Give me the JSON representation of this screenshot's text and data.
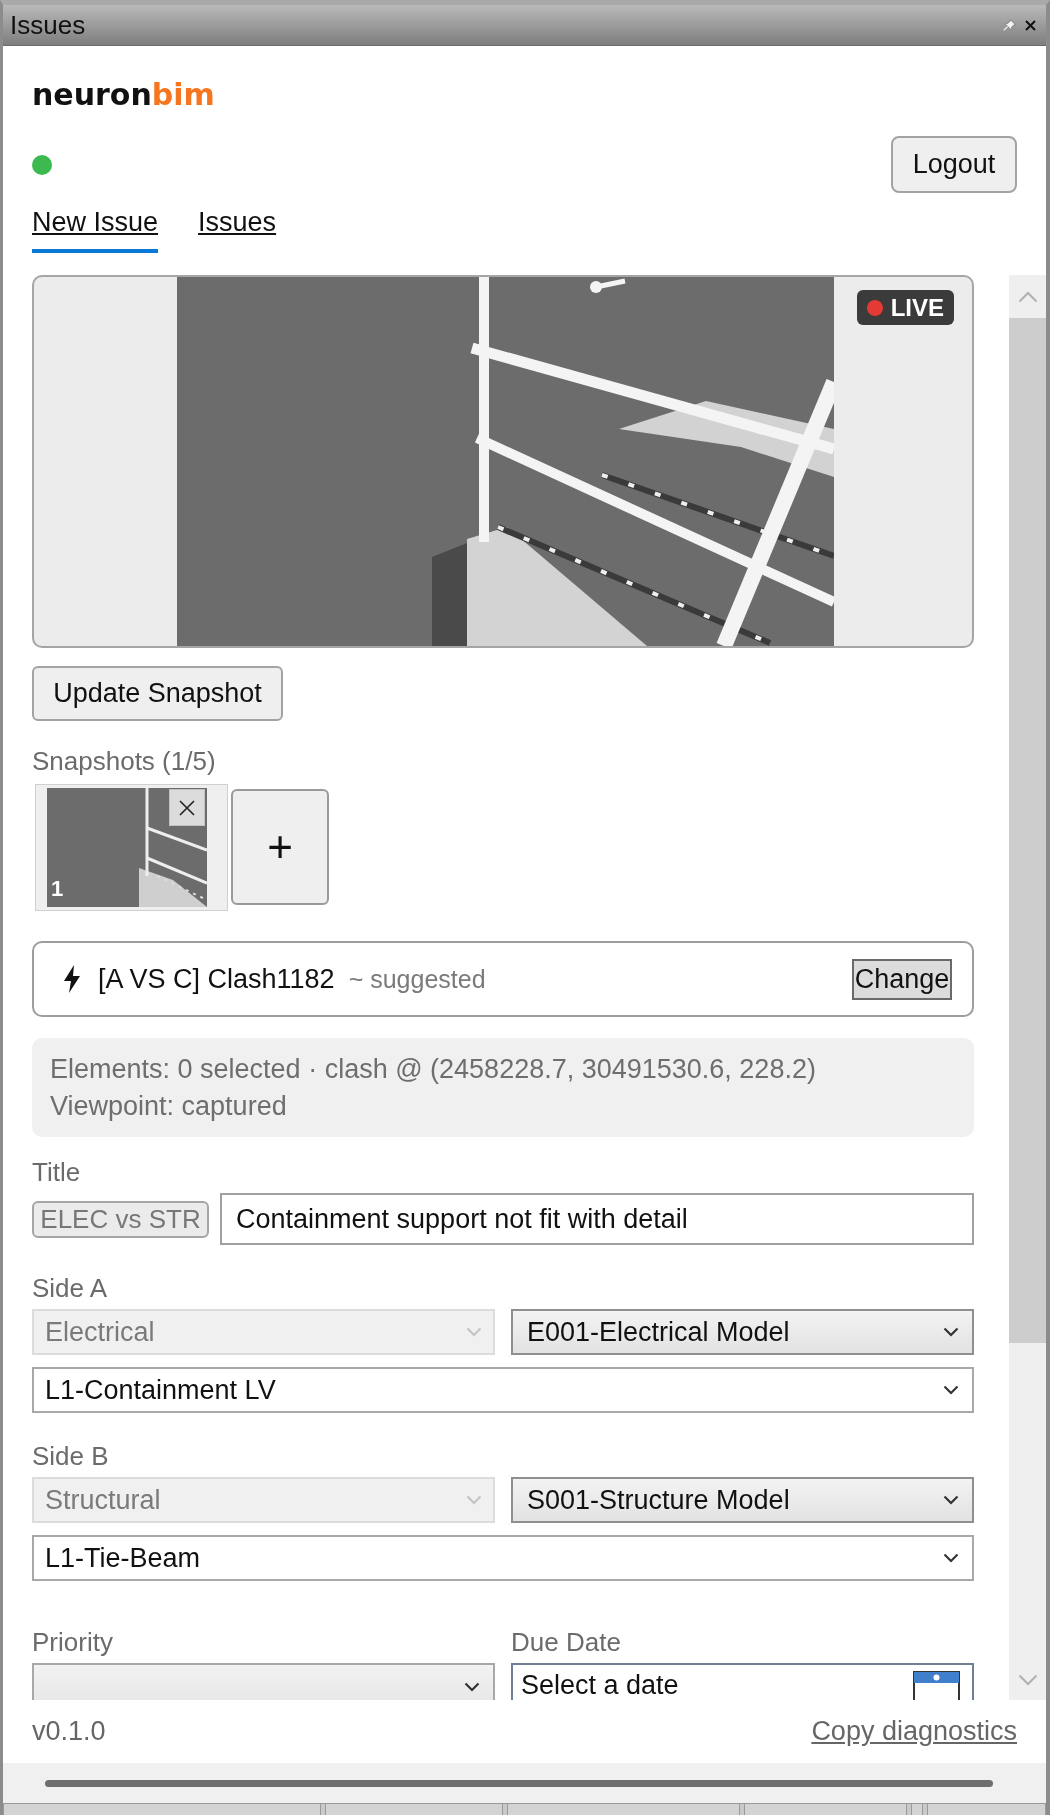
{
  "window": {
    "title": "Issues"
  },
  "logo": {
    "text": "neuron",
    "accent": "bim"
  },
  "connection": {
    "online": true
  },
  "logout_button": "Logout",
  "tabs": [
    {
      "label": "New Issue",
      "selected": true
    },
    {
      "label": "Issues",
      "selected": false
    }
  ],
  "live_view": {
    "badge": "LIVE"
  },
  "update_button": "Update Snapshot",
  "snapshots": {
    "label": "Snapshots (1/5)",
    "items": [
      {
        "number": "1"
      }
    ],
    "add_button": "+"
  },
  "clash": {
    "name": "[A VS C] Clash1182",
    "hint": "~ suggested",
    "button": "Change"
  },
  "info": {
    "elements": "Elements: 0 selected · clash @ (2458228.7, 30491530.6, 228.2)",
    "viewpoint": "Viewpoint: captured"
  },
  "title_field": {
    "label": "Title",
    "tag": "ELEC vs STR",
    "value": "Containment support not fit with detail"
  },
  "sides": [
    {
      "label": "Side A",
      "discipline": {
        "value": "Electrical",
        "disabled": true
      },
      "model": {
        "value": "E001-Electrical Model",
        "disabled": false
      },
      "element": {
        "value": "L1-Containment LV",
        "disabled": false
      }
    },
    {
      "label": "Side B",
      "discipline": {
        "value": "Structural",
        "disabled": true
      },
      "model": {
        "value": "S001-Structure Model",
        "disabled": false
      },
      "element": {
        "value": "L1-Tie-Beam",
        "disabled": false
      }
    }
  ],
  "priority": {
    "label": "Priority"
  },
  "due_date": {
    "label": "Due Date",
    "placeholder": "Select a date"
  },
  "footer": {
    "version": "v0.1.0",
    "link": "Copy diagnostics"
  }
}
